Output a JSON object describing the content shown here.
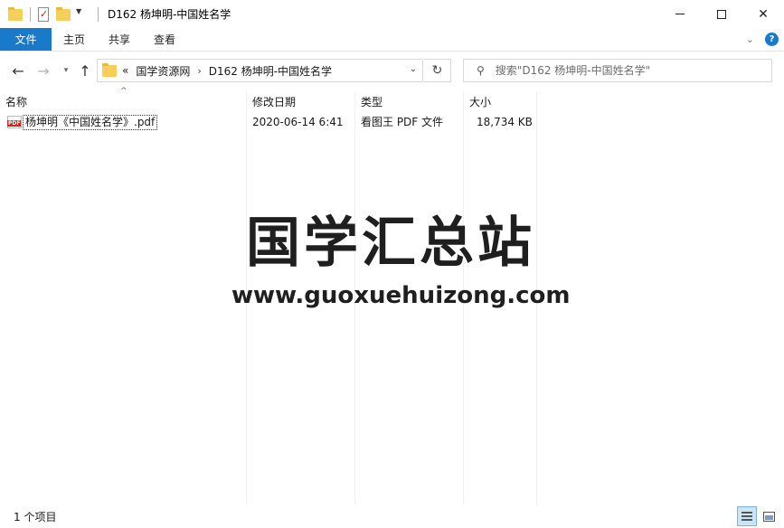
{
  "window": {
    "title": "D162 杨坤明-中国姓名学"
  },
  "ribbon": {
    "tabs": [
      "文件",
      "主页",
      "共享",
      "查看"
    ]
  },
  "address": {
    "prefix": "«",
    "crumbs": [
      "国学资源网",
      "D162 杨坤明-中国姓名学"
    ]
  },
  "search": {
    "placeholder": "搜索\"D162 杨坤明-中国姓名学\""
  },
  "columns": [
    "名称",
    "修改日期",
    "类型",
    "大小"
  ],
  "files": [
    {
      "name": "杨坤明《中国姓名学》.pdf",
      "modified": "2020-06-14 6:41",
      "type": "看图王 PDF 文件",
      "size": "18,734 KB",
      "icon_text": "PDF"
    }
  ],
  "watermark": {
    "title": "国学汇总站",
    "url": "www.guoxuehuizong.com"
  },
  "status": {
    "item_count": "1 个项目"
  },
  "colors": {
    "accent": "#1979ca",
    "folder": "#f6cf5b",
    "pdf_red": "#c62828"
  }
}
